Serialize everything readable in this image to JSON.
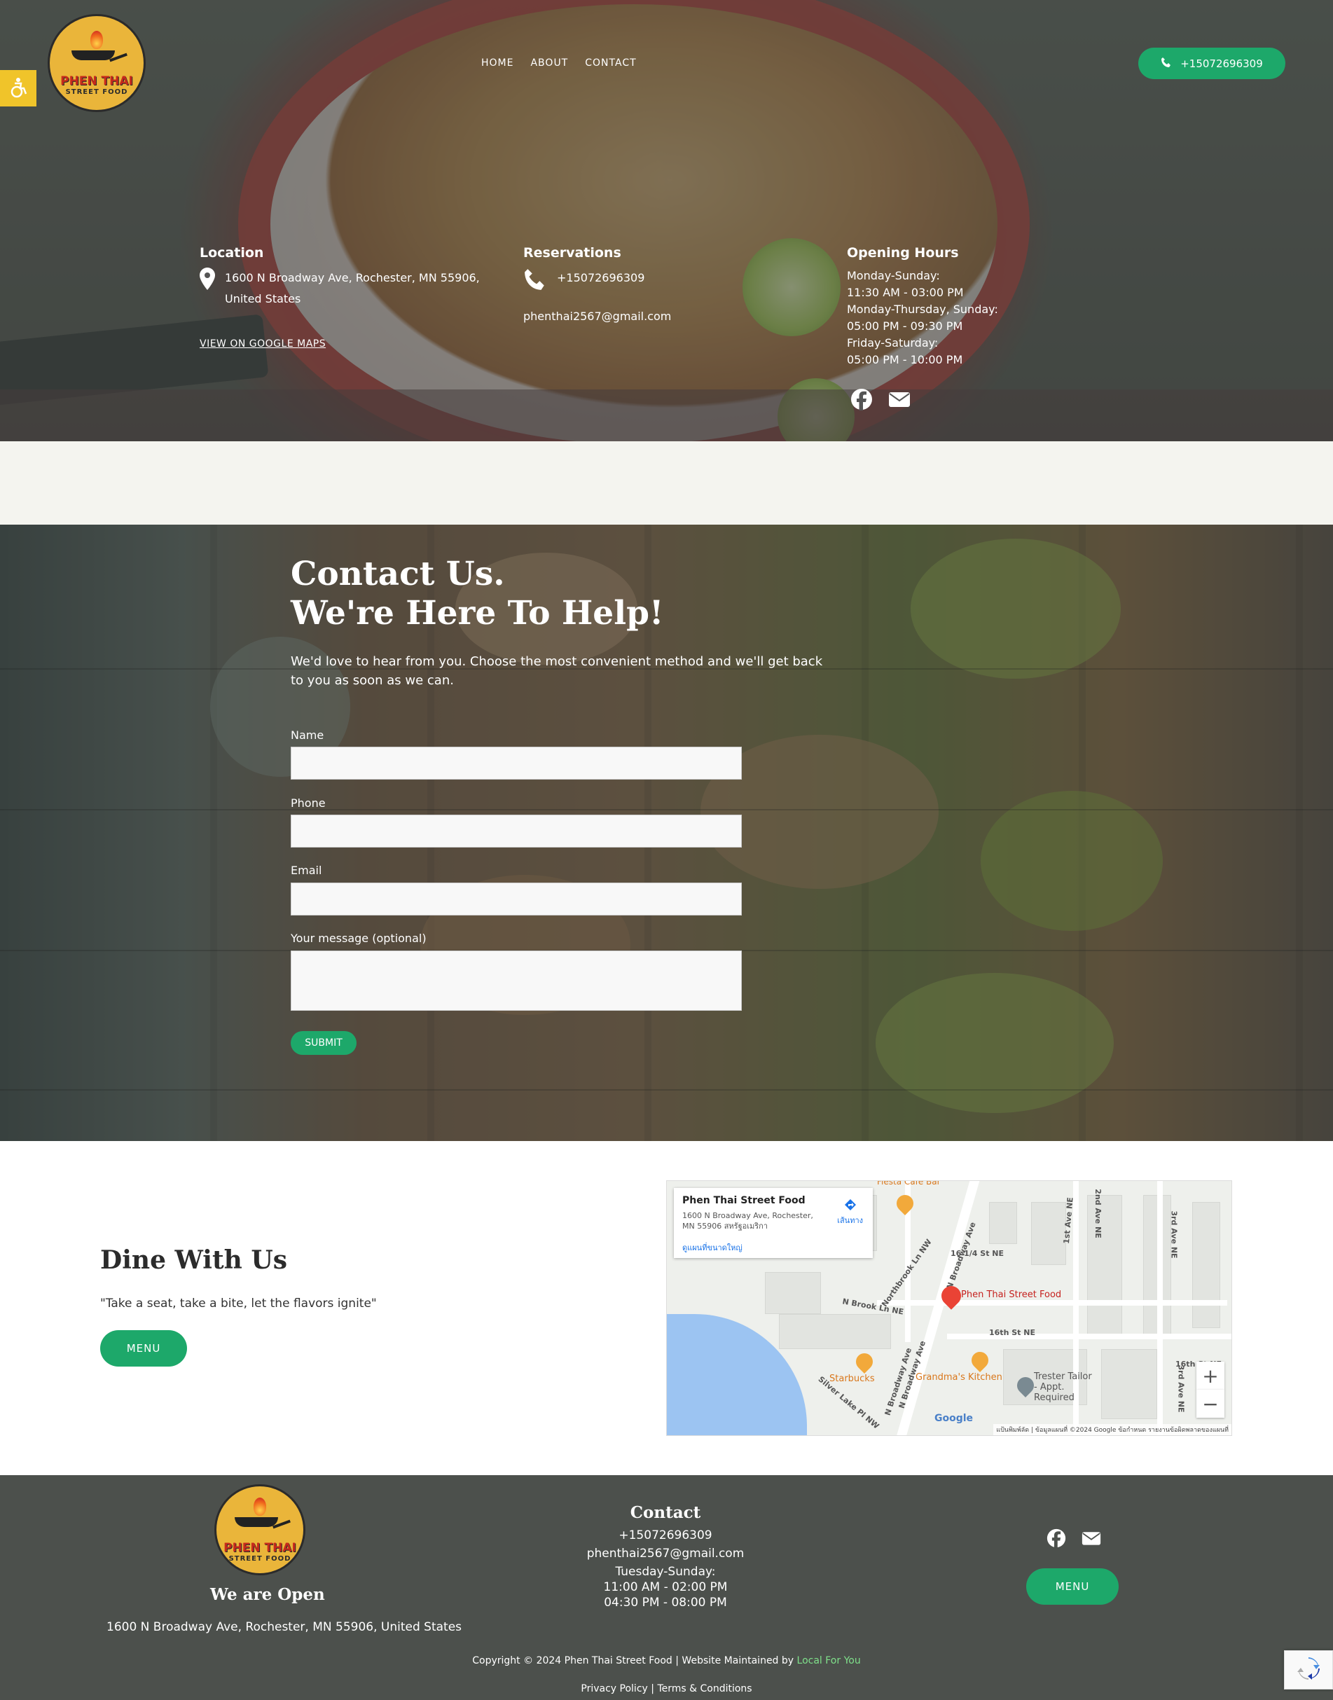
{
  "brand": {
    "logo_line1": "PHEN THAI",
    "logo_line2": "STREET FOOD"
  },
  "nav": {
    "items": [
      "HOME",
      "ABOUT",
      "CONTACT"
    ]
  },
  "header": {
    "phone_label": "+15072696309"
  },
  "info": {
    "location": {
      "heading": "Location",
      "address_line1": "1600 N Broadway Ave, Rochester, MN 55906,",
      "address_line2": "United States",
      "map_link": "VIEW ON GOOGLE MAPS"
    },
    "reservations": {
      "heading": "Reservations",
      "phone": "+15072696309",
      "email": "phenthai2567@gmail.com"
    },
    "hours": {
      "heading": "Opening Hours",
      "lines": [
        "Monday-Sunday:",
        "11:30 AM - 03:00 PM",
        "Monday-Thursday, Sunday:",
        "05:00 PM - 09:30 PM",
        "Friday-Saturday:",
        "05:00 PM - 10:00 PM"
      ]
    },
    "social_icons": [
      "facebook-icon",
      "envelope-icon"
    ]
  },
  "contact": {
    "title_line1": "Contact Us.",
    "title_line2": "We're Here To Help!",
    "intro": "We'd love to hear from you. Choose the most convenient method and we'll get back to you as soon as we can.",
    "fields": [
      {
        "label": "Name",
        "value": ""
      },
      {
        "label": "Phone",
        "value": ""
      },
      {
        "label": "Email",
        "value": ""
      },
      {
        "label": "Your message (optional)",
        "value": ""
      }
    ],
    "submit_label": "SUBMIT"
  },
  "dine": {
    "title": "Dine With Us",
    "quote": "\"Take a seat, take a bite, let the flavors ignite\"",
    "menu_label": "MENU"
  },
  "map": {
    "place_name": "Phen Thai Street Food",
    "place_address": "1600 N Broadway Ave, Rochester, MN 55906 สหรัฐอเมริกา",
    "directions_label": "เส้นทาง",
    "larger_map_label": "ดูแผนที่ขนาดใหญ่",
    "pin_label": "Phen Thai Street Food",
    "roads": [
      "N Broadway Ave",
      "N Broadway Ave",
      "N Broadway Ave",
      "16 1/4 St NE",
      "16th St NE",
      "N Brook Ln NE",
      "Northbrook Ln NW",
      "Silver Lake Pl NW",
      "1st Ave NE",
      "2nd Ave NE",
      "3rd Ave NE",
      "16th St NE",
      "3rd Ave NE"
    ],
    "pois": [
      "Fiesta Cafe Bar",
      "Starbucks",
      "Grandma's Kitchen",
      "Trester Tailor - Appt. Required"
    ],
    "brand": "Google",
    "attribution": "แป้นพิมพ์ลัด | ข้อมูลแผนที่ ©2024 Google   ข้อกำหนด   รายงานข้อผิดพลาดของแผนที่",
    "zoom_in": "+",
    "zoom_out": "−"
  },
  "footer": {
    "open_title": "We are Open",
    "address": "1600 N Broadway Ave, Rochester, MN 55906, United States",
    "contact_heading": "Contact",
    "phone": "+15072696309",
    "email": "phenthai2567@gmail.com",
    "hours_label": "Tuesday-Sunday:",
    "hours_1": "11:00 AM - 02:00 PM",
    "hours_2": "04:30 PM - 08:00 PM",
    "menu_label": "MENU",
    "copyright": "Copyright © 2024 Phen Thai Street Food | Website Maintained by ",
    "maintainer": "Local For You",
    "privacy": "Privacy Policy",
    "terms": "Terms & Conditions"
  },
  "colors": {
    "accent": "#1da86a",
    "logo_bg": "#eab53a",
    "footer_bg": "#4c504c",
    "a11y_bg": "#f0c42a"
  }
}
